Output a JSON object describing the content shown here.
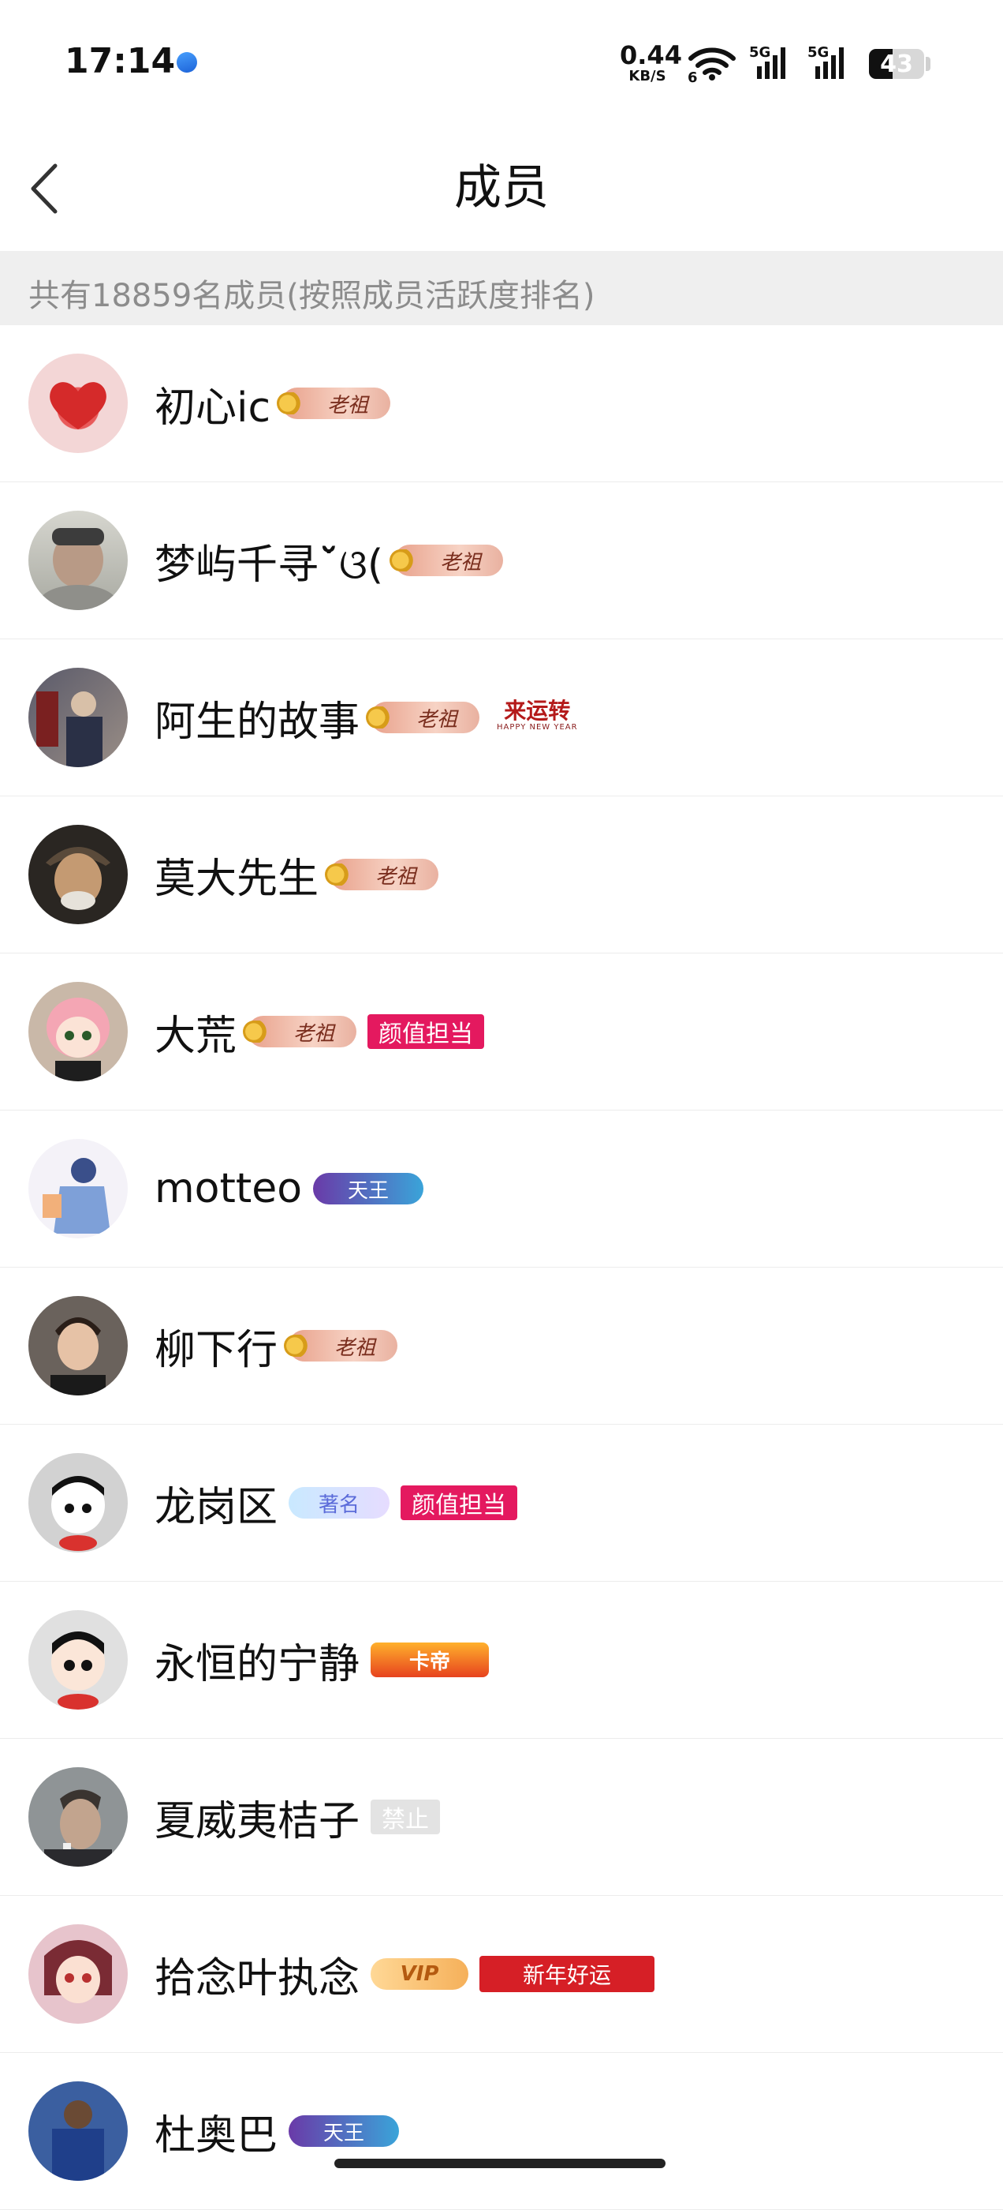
{
  "status_bar": {
    "time": "17:14",
    "net_speed_value": "0.44",
    "net_speed_unit": "KB/S",
    "wifi_sub": "6",
    "sim1_label": "5G",
    "sim2_label": "5G",
    "battery": "43",
    "battery_level": 0.43
  },
  "nav": {
    "title": "成员"
  },
  "summary": {
    "text": "共有18859名成员(按照成员活跃度排名)"
  },
  "members": [
    {
      "name": "初心ic",
      "badges": [
        "老祖"
      ]
    },
    {
      "name": "梦屿千寻ˇ̆ଓ(",
      "badges": [
        "老祖"
      ]
    },
    {
      "name": "阿生的故事",
      "badges": [
        "老祖",
        "来运转",
        "HAPPY NEW YEAR"
      ]
    },
    {
      "name": "莫大先生",
      "badges": [
        "老祖"
      ]
    },
    {
      "name": "大荒",
      "badges": [
        "老祖",
        "颜值担当"
      ]
    },
    {
      "name": "motteo",
      "badges": [
        "天王"
      ]
    },
    {
      "name": "柳下行",
      "badges": [
        "老祖"
      ]
    },
    {
      "name": "龙岗区",
      "badges": [
        "著名",
        "颜值担当"
      ]
    },
    {
      "name": "永恒的宁静",
      "badges": [
        "卡帝"
      ]
    },
    {
      "name": "夏威夷桔子",
      "badges": [
        "禁止"
      ]
    },
    {
      "name": "拾念叶执念",
      "badges": [
        "VIP",
        "新年好运"
      ]
    },
    {
      "name": "杜奥巴",
      "badges": [
        "天王"
      ]
    }
  ]
}
